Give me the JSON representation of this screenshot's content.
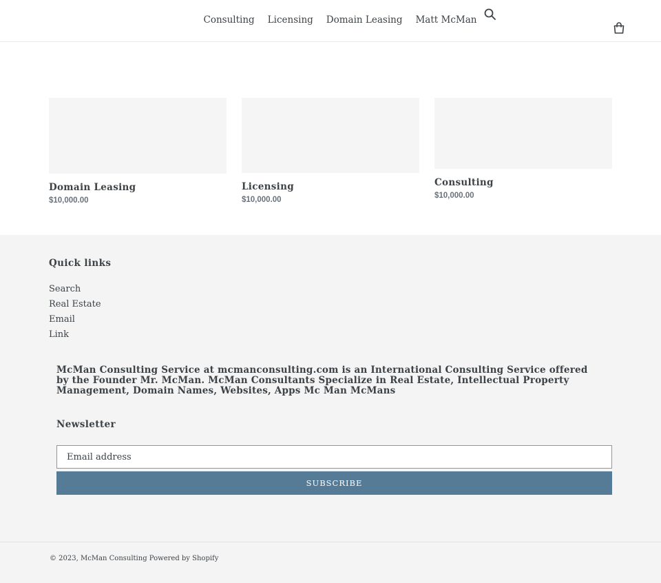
{
  "header": {
    "nav": [
      "Consulting",
      "Licensing",
      "Domain Leasing",
      "Matt McMan"
    ],
    "search_icon": "search-icon",
    "cart_icon": "cart-icon"
  },
  "products": [
    {
      "title": "Domain Leasing",
      "price": "$10,000.00"
    },
    {
      "title": "Licensing",
      "price": "$10,000.00"
    },
    {
      "title": "Consulting",
      "price": "$10,000.00"
    }
  ],
  "footer": {
    "quick_links_title": "Quick links",
    "quick_links": [
      "Search",
      "Real Estate",
      "Email",
      "Link"
    ],
    "about": "McMan Consulting Service at mcmanconsulting.com is an International Consulting Service offered by the Founder Mr. McMan. McMan Consultants Specialize in Real Estate, Intellectual Property Management, Domain Names, Websites, Apps Mc Man McMans",
    "newsletter_title": "Newsletter",
    "email_placeholder": "Email address",
    "subscribe_label": "SUBSCRIBE",
    "copyright_prefix": "© 2023,",
    "store_name": "McMan Consulting",
    "powered_by": "Powered by Shopify"
  },
  "colors": {
    "accent": "#557b97",
    "footer_bg": "#f4f4f4",
    "thumb_bg": "#f5f5f5"
  }
}
